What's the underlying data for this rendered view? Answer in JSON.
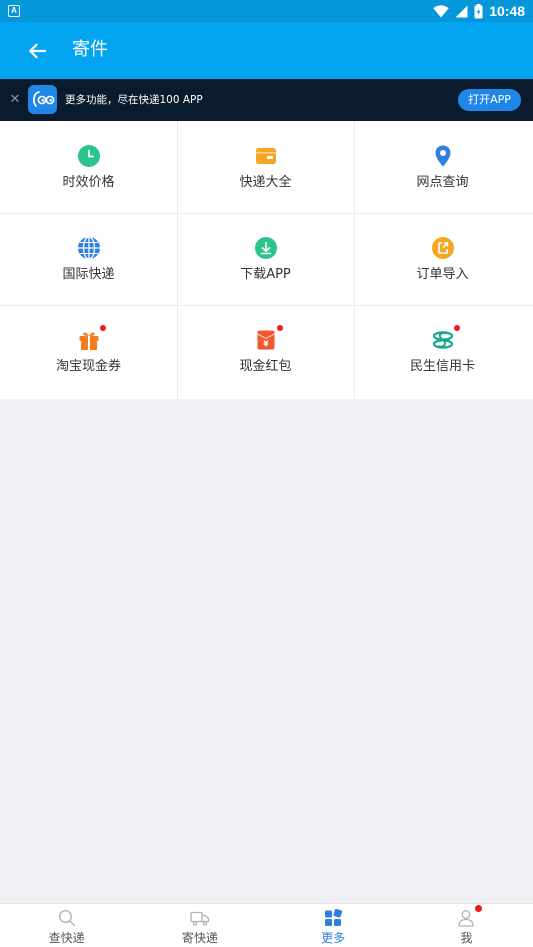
{
  "status_bar": {
    "notification": "A",
    "time": "10:48"
  },
  "header": {
    "title": "寄件"
  },
  "promo": {
    "text": "更多功能，尽在快递100 APP",
    "open_label": "打开APP"
  },
  "grid": {
    "items": [
      {
        "label": "时效价格",
        "icon": "clock-icon",
        "color": "#2bc48a"
      },
      {
        "label": "快递大全",
        "icon": "wallet-icon",
        "color": "#f6a623"
      },
      {
        "label": "网点查询",
        "icon": "location-pin-icon",
        "color": "#2f7fe0"
      },
      {
        "label": "国际快递",
        "icon": "globe-icon",
        "color": "#2f7fe0"
      },
      {
        "label": "下载APP",
        "icon": "download-icon",
        "color": "#2bc48a"
      },
      {
        "label": "订单导入",
        "icon": "import-icon",
        "color": "#f6a623"
      },
      {
        "label": "淘宝现金券",
        "icon": "gift-icon",
        "color": "#f57c1f",
        "badge": true
      },
      {
        "label": "现金红包",
        "icon": "red-envelope-icon",
        "color": "#f0582f",
        "badge": true
      },
      {
        "label": "民生信用卡",
        "icon": "minsheng-bank-icon",
        "color": "#1aa68a",
        "badge": true
      }
    ]
  },
  "bottom_nav": {
    "items": [
      {
        "label": "查快递",
        "icon": "search-icon",
        "active": false
      },
      {
        "label": "寄快递",
        "icon": "truck-icon",
        "active": false
      },
      {
        "label": "更多",
        "icon": "apps-icon",
        "active": true
      },
      {
        "label": "我",
        "icon": "person-icon",
        "active": false,
        "badge": true
      }
    ]
  },
  "colors": {
    "status_bar": "#0696da",
    "header": "#03a5f0",
    "promo_bg": "#0a1b2e",
    "accent": "#2f7fe0",
    "badge": "#f01b1b",
    "background": "#efeff4"
  }
}
